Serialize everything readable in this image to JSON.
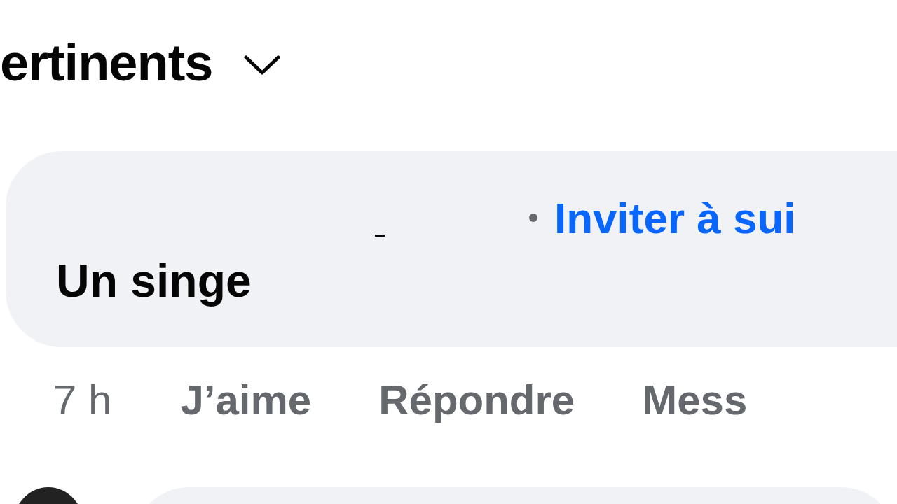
{
  "sort_menu": {
    "label": "ertinents"
  },
  "comments": [
    {
      "author_link": "Inviter à sui",
      "text": "Un singe",
      "time": "7 h",
      "actions": [
        "J’aime",
        "Répondre",
        "Mess"
      ]
    }
  ]
}
